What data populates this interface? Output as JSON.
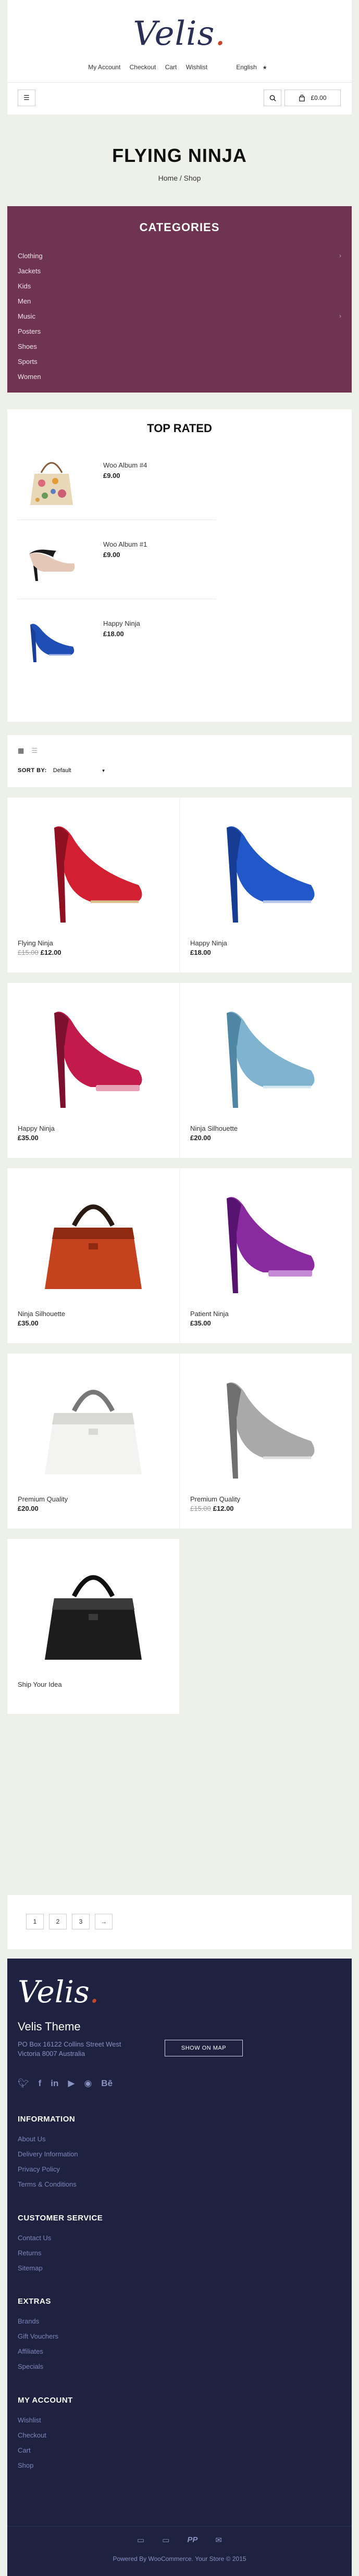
{
  "brand": {
    "name": "Velis",
    "accent": "#c9462a",
    "navy": "#1e2240",
    "plum": "#6e3452"
  },
  "topnav": {
    "items": [
      "My Account",
      "Checkout",
      "Cart",
      "Wishlist"
    ],
    "language": "English"
  },
  "header": {
    "menu_icon": "hamburger-icon",
    "search_icon": "search-icon",
    "cart_icon": "bag-icon",
    "cart_total": "£0.00"
  },
  "page": {
    "title": "FLYING NINJA",
    "breadcrumb": "Home / Shop"
  },
  "categories": {
    "title": "CATEGORIES",
    "items": [
      {
        "label": "Clothing",
        "has_children": true
      },
      {
        "label": "Jackets",
        "has_children": false
      },
      {
        "label": "Kids",
        "has_children": false
      },
      {
        "label": "Men",
        "has_children": false
      },
      {
        "label": "Music",
        "has_children": true
      },
      {
        "label": "Posters",
        "has_children": false
      },
      {
        "label": "Shoes",
        "has_children": false
      },
      {
        "label": "Sports",
        "has_children": false
      },
      {
        "label": "Women",
        "has_children": false
      }
    ]
  },
  "top_rated": {
    "title": "TOP RATED",
    "items": [
      {
        "name": "Woo Album #4",
        "price": "£9.00",
        "image": "floral-handbag"
      },
      {
        "name": "Woo Album #1",
        "price": "£9.00",
        "image": "black-nude-pump"
      },
      {
        "name": "Happy Ninja",
        "price": "£18.00",
        "image": "blue-heel"
      }
    ]
  },
  "sort": {
    "label": "SORT BY:",
    "value": "Default"
  },
  "products": [
    {
      "name": "Flying Ninja",
      "old_price": "£15.00",
      "price": "£12.00",
      "image": "red-heel"
    },
    {
      "name": "Happy Ninja",
      "old_price": "",
      "price": "£18.00",
      "image": "blue-heel"
    },
    {
      "name": "Happy Ninja",
      "old_price": "",
      "price": "£35.00",
      "image": "pink-platform-heel"
    },
    {
      "name": "Ninja Silhouette",
      "old_price": "",
      "price": "£20.00",
      "image": "light-blue-heel"
    },
    {
      "name": "Ninja Silhouette",
      "old_price": "",
      "price": "£35.00",
      "image": "red-handbag"
    },
    {
      "name": "Patient Ninja",
      "old_price": "",
      "price": "£35.00",
      "image": "purple-platform-heel"
    },
    {
      "name": "Premium Quality",
      "old_price": "",
      "price": "£20.00",
      "image": "white-handbag"
    },
    {
      "name": "Premium Quality",
      "old_price": "£15.00",
      "price": "£12.00",
      "image": "silver-heel"
    },
    {
      "name": "Ship Your Idea",
      "old_price": "",
      "price": "",
      "image": "black-handbag"
    }
  ],
  "pagination": {
    "pages": [
      "1",
      "2",
      "3",
      "→"
    ]
  },
  "footer": {
    "theme_name": "Velis Theme",
    "address": "PO Box 16122 Collins Street West Victoria 8007 Australia",
    "map_button": "SHOW ON MAP",
    "socials": [
      "twitter-icon",
      "facebook-icon",
      "linkedin-icon",
      "youtube-icon",
      "github-icon",
      "behance-icon"
    ],
    "sections": [
      {
        "title": "INFORMATION",
        "links": [
          "About Us",
          "Delivery Information",
          "Privacy Policy",
          "Terms & Conditions"
        ]
      },
      {
        "title": "CUSTOMER SERVICE",
        "links": [
          "Contact Us",
          "Returns",
          "Sitemap"
        ]
      },
      {
        "title": "EXTRAS",
        "links": [
          "Brands",
          "Gift Vouchers",
          "Affiliates",
          "Specials"
        ]
      },
      {
        "title": "MY ACCOUNT",
        "links": [
          "Wishlist",
          "Checkout",
          "Cart",
          "Shop"
        ]
      }
    ],
    "payments": [
      "card-icon",
      "card-icon",
      "paypal-icon",
      "card-icon"
    ],
    "copyright": "Powered By WooCommerce. Your Store © 2015"
  }
}
